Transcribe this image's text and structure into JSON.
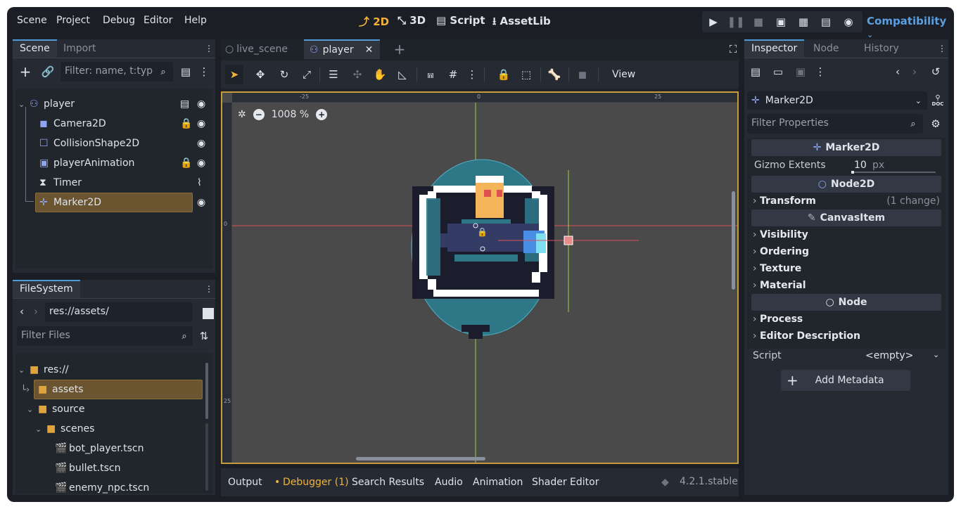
{
  "menu": [
    "Scene",
    "Project",
    "Debug",
    "Editor",
    "Help"
  ],
  "workspaces": [
    {
      "icon": "2d-icon",
      "glyph": "⤴",
      "label": "2D"
    },
    {
      "icon": "3d-icon",
      "glyph": "⤡",
      "label": "3D"
    },
    {
      "icon": "script-icon",
      "glyph": "▤",
      "label": "Script"
    },
    {
      "icon": "assetlib-icon",
      "glyph": "⭳",
      "label": "AssetLib"
    }
  ],
  "renderer": "Compatibility",
  "scene_dock": {
    "tabs": [
      "Scene",
      "Import"
    ],
    "filter_placeholder": "Filter: name, t:typ",
    "tree": [
      {
        "name": "player",
        "icon": "player-node-icon"
      },
      {
        "name": "Camera2D",
        "icon": "camera2d-icon"
      },
      {
        "name": "CollisionShape2D",
        "icon": "collisionshape-icon"
      },
      {
        "name": "playerAnimation",
        "icon": "animatedsprite-icon"
      },
      {
        "name": "Timer",
        "icon": "timer-icon"
      },
      {
        "name": "Marker2D",
        "icon": "marker2d-icon"
      }
    ]
  },
  "filesystem": {
    "tab": "FileSystem",
    "path": "res://assets/",
    "filter_placeholder": "Filter Files",
    "items": [
      {
        "name": "res://",
        "type": "folder"
      },
      {
        "name": "assets",
        "type": "folder"
      },
      {
        "name": "source",
        "type": "folder"
      },
      {
        "name": "scenes",
        "type": "folder"
      },
      {
        "name": "bot_player.tscn",
        "type": "scene"
      },
      {
        "name": "bullet.tscn",
        "type": "scene"
      },
      {
        "name": "enemy_npc.tscn",
        "type": "scene"
      }
    ]
  },
  "editor_tabs": [
    {
      "name": "live_scene",
      "icon": "circle-icon"
    },
    {
      "name": "player",
      "icon": "player-node-icon"
    }
  ],
  "toolbar": {
    "view_label": "View"
  },
  "viewport": {
    "zoom": "1008 %",
    "ruler_top": [
      "-25",
      "0",
      "25"
    ],
    "ruler_left": [
      "0",
      "25"
    ]
  },
  "bottom_tabs": [
    "Output",
    "Debugger (1)",
    "Search Results",
    "Audio",
    "Animation",
    "Shader Editor"
  ],
  "version": "4.2.1.stable",
  "inspector": {
    "tabs": [
      "Inspector",
      "Node",
      "History"
    ],
    "node_name": "Marker2D",
    "filter_placeholder": "Filter Properties",
    "class_header": "Marker2D",
    "gizmo_label": "Gizmo Extents",
    "gizmo_value": "10",
    "gizmo_unit": "px",
    "node2d_header": "Node2D",
    "transform": "Transform",
    "transform_note": "(1 change)",
    "canvasitem_header": "CanvasItem",
    "canvasitem_props": [
      "Visibility",
      "Ordering",
      "Texture",
      "Material"
    ],
    "node_header": "Node",
    "node_props": [
      "Process",
      "Editor Description"
    ],
    "script_label": "Script",
    "script_value": "<empty>",
    "add_metadata": "Add Metadata",
    "doc_label": "DOC"
  },
  "colors": {
    "accent": "#4f9bd8",
    "selection": "#6b5530",
    "viewport_frame": "#c79a3a",
    "teal": "#2e7787"
  }
}
